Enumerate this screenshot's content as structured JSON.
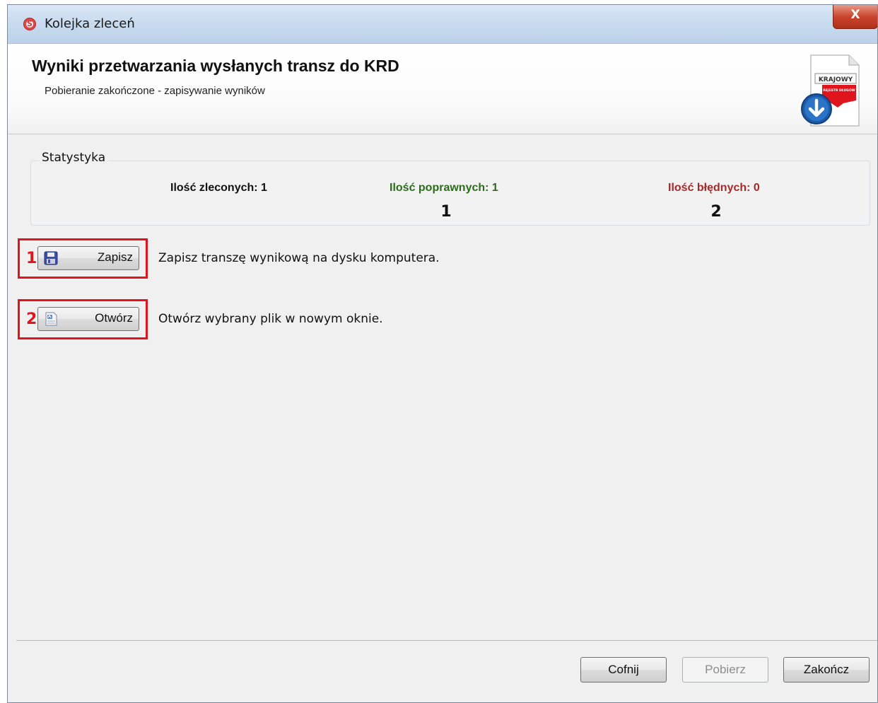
{
  "window": {
    "title": "Kolejka zleceń",
    "close_label": "X",
    "app_icon": "app-logo-icon"
  },
  "header": {
    "title": "Wyniki przetwarzania wysłanych transz do KRD",
    "subtitle": "Pobieranie zakończone - zapisywanie wyników",
    "logo_text": "KRAJOWY",
    "logo_subtext": "REJESTR DŁUGÓW",
    "icon": "download-document-icon"
  },
  "stats": {
    "group_label": "Statystyka",
    "ordered_label": "Ilość zleconych: 1",
    "correct_label": "Ilość poprawnych: 1",
    "errors_label": "Ilość błędnych: 0",
    "marker_1": "1",
    "marker_2": "2",
    "colors": {
      "ordered": "#111111",
      "correct": "#2e6b1c",
      "errors": "#a52a2a"
    }
  },
  "actions": {
    "save": {
      "callout": "1",
      "label": "Zapisz",
      "description": "Zapisz transzę wynikową na dysku komputera.",
      "icon": "floppy-disk-icon"
    },
    "open": {
      "callout": "2",
      "label": "Otwórz",
      "description": "Otwórz wybrany plik w nowym oknie.",
      "icon": "open-document-icon"
    },
    "callout_color": "#e0141c"
  },
  "footer": {
    "back_label": "Cofnij",
    "download_label": "Pobierz",
    "finish_label": "Zakończ"
  }
}
